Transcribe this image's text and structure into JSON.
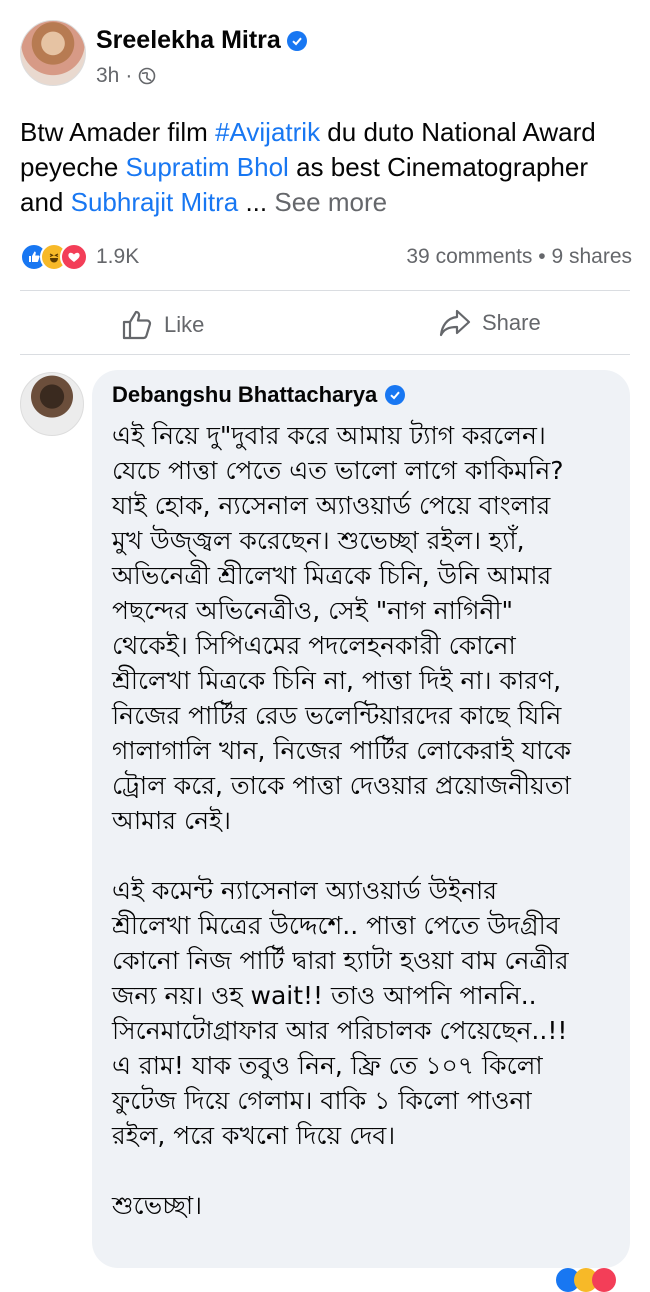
{
  "post": {
    "author": "Sreelekha Mitra",
    "time": "3h",
    "text_parts": {
      "p1": "Btw Amader film ",
      "hashtag": "#Avijatrik",
      "p2": " du duto National Award peyeche ",
      "mention1": "Supratim Bhol",
      "p3": " as best Cinematographer and ",
      "mention2": "Subhrajit Mitra",
      "p4": " ... ",
      "see_more": "See more"
    },
    "reaction_count": "1.9K",
    "comments_shares": "39 comments • 9 shares"
  },
  "actions": {
    "like": "Like",
    "share": "Share"
  },
  "comment": {
    "author": "Debangshu Bhattacharya",
    "text": "এই নিয়ে দু\"দুবার করে আমায় ট্যাগ করলেন।\nযেচে পাত্তা পেতে এত ভালো লাগে কাকিমনি?\nযাই হোক, ন্যসেনাল অ্যাওয়ার্ড পেয়ে বাংলার\nমুখ উজ্জ্বল করেছেন। শুভেচ্ছা রইল। হ্যাঁ,\nঅভিনেত্রী শ্রীলেখা মিত্রকে চিনি, উনি আমার\nপছন্দের অভিনেত্রীও, সেই \"নাগ নাগিনী\"\nথেকেই। সিপিএমের পদলেহনকারী কোনো\nশ্রীলেখা মিত্রকে চিনি না, পাত্তা দিই না। কারণ,\nনিজের পার্টির রেড ভলেন্টিয়ারদের কাছে যিনি\nগালাগালি খান, নিজের পার্টির লোকেরাই যাকে\nট্রোল করে, তাকে পাত্তা দেওয়ার প্রয়োজনীয়তা\nআমার নেই।\n\nএই কমেন্ট ন্যাসেনাল অ্যাওয়ার্ড উইনার\nশ্রীলেখা মিত্রের উদ্দেশে.. পাত্তা পেতে উদগ্রীব\nকোনো নিজ পার্টি দ্বারা হ্যাটা হওয়া বাম নেত্রীর\nজন্য নয়। ওহ wait!! তাও আপনি পাননি..\nসিনেমাটোগ্রাফার আর পরিচালক পেয়েছেন..!!\nএ রাম! যাক তবুও নিন, ফ্রি তে ১০৭ কিলো\nফুটেজ দিয়ে গেলাম। বাকি ১ কিলো পাওনা\nরইল, পরে কখনো দিয়ে দেব।\n\nশুভেচ্ছা।"
  },
  "icons": {
    "verified": "verified-badge-icon",
    "globe": "globe-icon",
    "like": "thumbs-up-icon",
    "share": "share-arrow-icon"
  },
  "colors": {
    "accent": "#1877f2",
    "secondary_text": "#65676b",
    "bubble": "#eff2f6"
  }
}
